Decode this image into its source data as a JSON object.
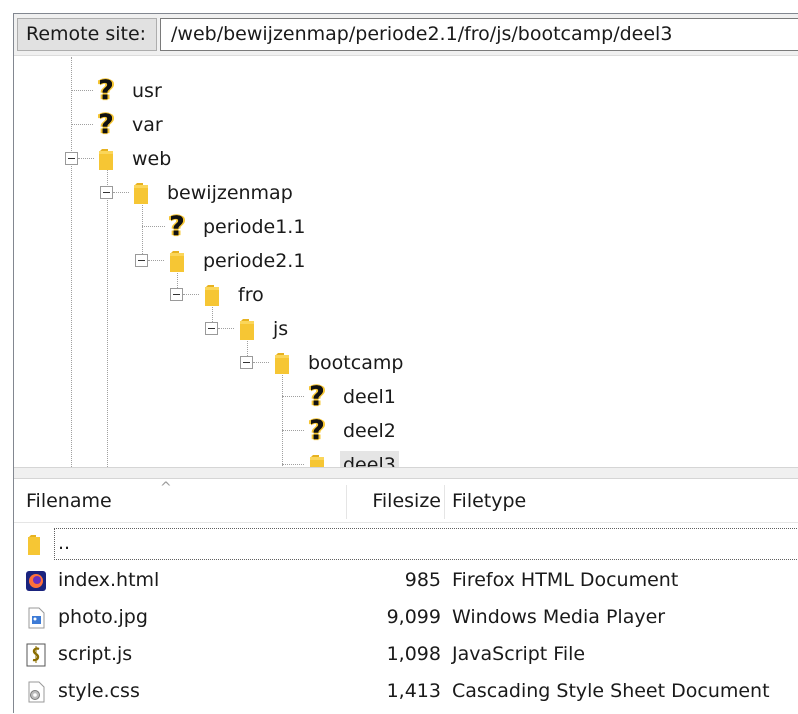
{
  "address_bar": {
    "label": "Remote site:",
    "path": "/web/bewijzenmap/periode2.1/fro/js/bootcamp/deel3"
  },
  "tree": {
    "nodes": [
      {
        "name": "usr",
        "icon": "unknown-folder-icon"
      },
      {
        "name": "var",
        "icon": "unknown-folder-icon"
      },
      {
        "name": "web",
        "icon": "folder-icon",
        "expanded": true
      },
      {
        "name": "bewijzenmap",
        "icon": "folder-icon",
        "expanded": true
      },
      {
        "name": "periode1.1",
        "icon": "unknown-folder-icon"
      },
      {
        "name": "periode2.1",
        "icon": "folder-icon",
        "expanded": true
      },
      {
        "name": "fro",
        "icon": "folder-icon",
        "expanded": true
      },
      {
        "name": "js",
        "icon": "folder-icon",
        "expanded": true
      },
      {
        "name": "bootcamp",
        "icon": "folder-icon",
        "expanded": true
      },
      {
        "name": "deel1",
        "icon": "unknown-folder-icon"
      },
      {
        "name": "deel2",
        "icon": "unknown-folder-icon"
      },
      {
        "name": "deel3",
        "icon": "folder-icon",
        "selected": true
      }
    ]
  },
  "file_list": {
    "columns": {
      "filename": "Filename",
      "filesize": "Filesize",
      "filetype": "Filetype"
    },
    "sort_indicator": "^",
    "rows": [
      {
        "filename": "..",
        "filesize": "",
        "filetype": "",
        "icon": "folder-icon"
      },
      {
        "filename": "index.html",
        "filesize": "985",
        "filetype": "Firefox HTML Document",
        "icon": "firefox-icon"
      },
      {
        "filename": "photo.jpg",
        "filesize": "9,099",
        "filetype": "Windows Media Player",
        "icon": "image-file-icon"
      },
      {
        "filename": "script.js",
        "filesize": "1,098",
        "filetype": "JavaScript File",
        "icon": "script-file-icon"
      },
      {
        "filename": "style.css",
        "filesize": "1,413",
        "filetype": "Cascading Style Sheet Document",
        "icon": "css-file-icon"
      }
    ]
  },
  "colors": {
    "folder": "#f6c634",
    "selection": "#e5e5e5",
    "tree_lines": "#a0a0a0"
  }
}
